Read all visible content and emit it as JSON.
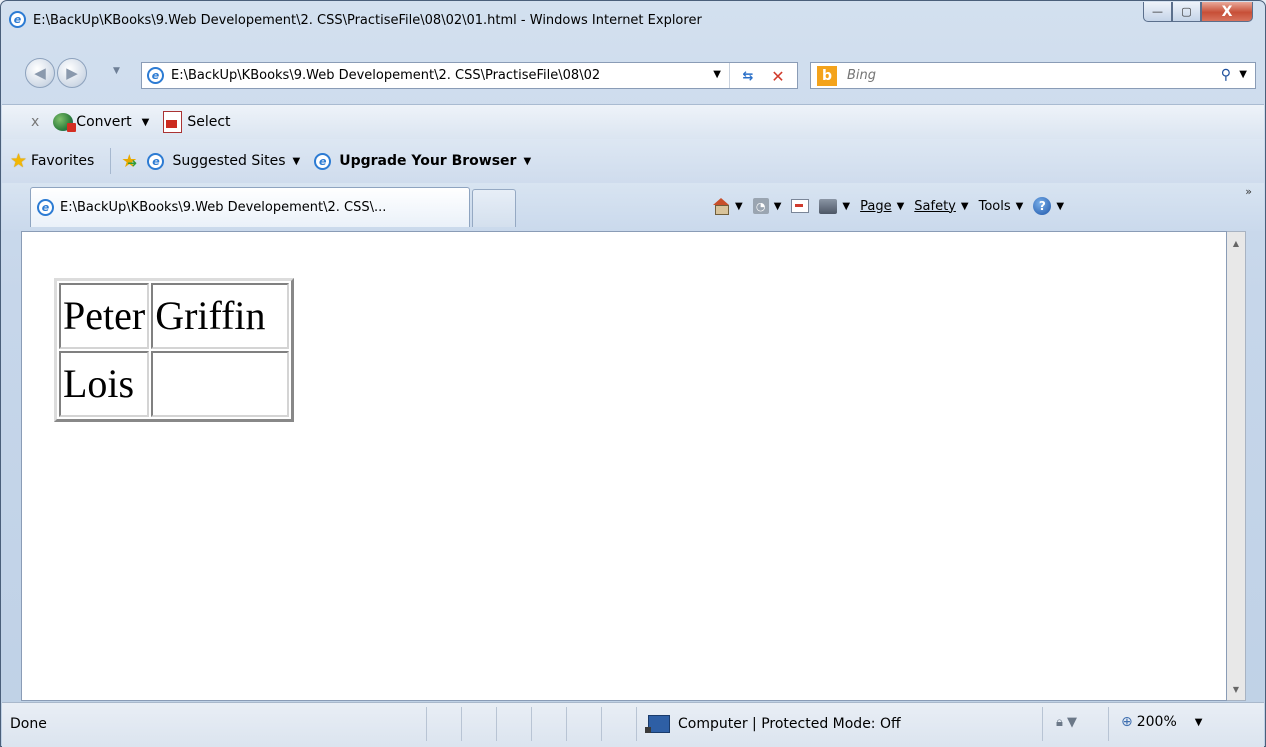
{
  "window": {
    "title": "E:\\BackUp\\KBooks\\9.Web Developement\\2. CSS\\PractiseFile\\08\\02\\01.html - Windows Internet Explorer",
    "minimize": "—",
    "maximize": "▢",
    "close": "X"
  },
  "nav": {
    "address": "E:\\BackUp\\KBooks\\9.Web Developement\\2. CSS\\PractiseFile\\08\\02",
    "refresh_glyph": "⇆",
    "stop_glyph": "✕"
  },
  "search": {
    "placeholder": "Bing",
    "logo": "b"
  },
  "commandbar": {
    "close": "x",
    "convert": "Convert",
    "select": "Select"
  },
  "favorites": {
    "label": "Favorites",
    "links": [
      "Suggested Sites",
      "Upgrade Your Browser"
    ]
  },
  "tabs": {
    "active_title": "E:\\BackUp\\KBooks\\9.Web Developement\\2. CSS\\..."
  },
  "tools": {
    "page": "Page",
    "safety": "Safety",
    "tools": "Tools",
    "help": "?"
  },
  "content": {
    "table": [
      [
        "Peter",
        "Griffin"
      ],
      [
        "Lois",
        ""
      ]
    ]
  },
  "status": {
    "text": "Done",
    "zone": "Computer | Protected Mode: Off",
    "zoom": "200%"
  },
  "icons": [
    "ie-icon",
    "back-arrow-icon",
    "forward-arrow-icon",
    "refresh-icon",
    "stop-icon",
    "search-icon",
    "convert-icon",
    "select-icon",
    "favorites-star-icon",
    "add-favorites-icon",
    "home-icon",
    "feed-icon",
    "mail-icon",
    "print-icon",
    "help-icon",
    "computer-zone-icon",
    "lock-icon",
    "zoom-icon"
  ]
}
